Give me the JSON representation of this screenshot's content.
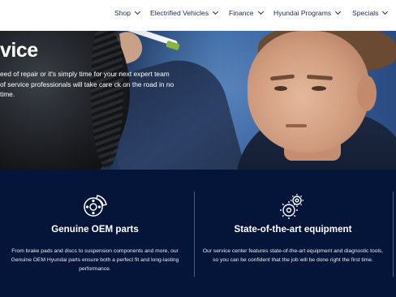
{
  "nav": {
    "items": [
      {
        "label": "Shop"
      },
      {
        "label": "Electrified Vehicles"
      },
      {
        "label": "Finance"
      },
      {
        "label": "Hyundai Programs"
      },
      {
        "label": "Specials"
      }
    ]
  },
  "hero": {
    "title": "vice",
    "text": "eed of repair or it's simply time for your next expert team of service professionals will take care ck on the road in no time."
  },
  "features": [
    {
      "icon": "brake-disc-icon",
      "title": "Genuine OEM parts",
      "text": "From brake pads and discs to suspension components and more, our Genuine OEM Hyundai parts ensure both a perfect fit and long-lasting performance."
    },
    {
      "icon": "gears-icon",
      "title": "State-of-the-art equipment",
      "text": "Our service center features state-of-the-art equipment and diagnostic tools, so you can be confident that the job will be done right the first time."
    }
  ],
  "colors": {
    "nav_text": "#1c2b4a",
    "features_bg": "#05153a",
    "divider": "#4a5b82"
  }
}
